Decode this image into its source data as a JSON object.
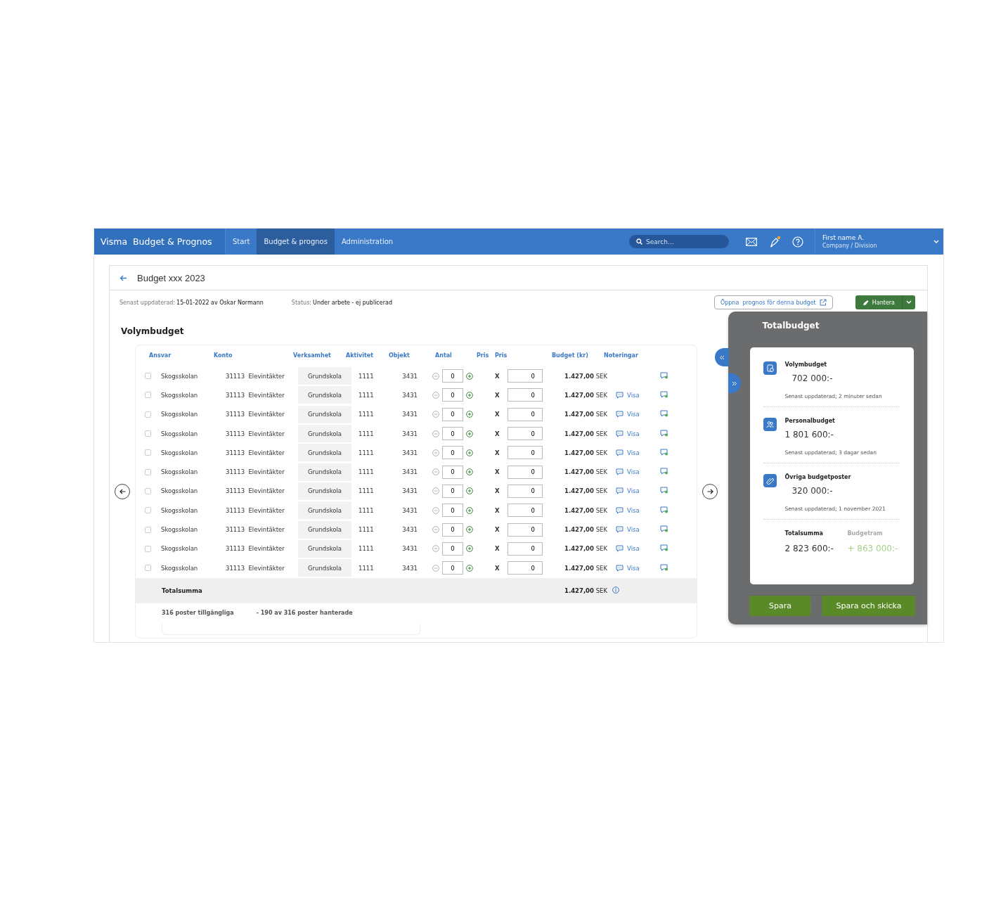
{
  "nav": {
    "brand": "Visma  Budget & Prognos",
    "tabs": [
      {
        "label": "Start",
        "selected": false
      },
      {
        "label": "Budget & prognos",
        "selected": true
      },
      {
        "label": "Administration",
        "selected": false
      }
    ],
    "search": {
      "placeholder": "Search..."
    },
    "user": {
      "name": "First name A.",
      "company": "Company / Division"
    }
  },
  "page": {
    "title": "Budget xxx 2023",
    "updated_label": "Senast uppdaterad:",
    "updated_value": "15-01-2022 av Oskar Normann",
    "status_label": "Status:",
    "status_value": "Under arbete - ej publicerad",
    "open_forecast": "Öppna  prognos för denna budget",
    "manage": "Hantera"
  },
  "table": {
    "title": "Volymbudget",
    "columns": [
      "Ansvar",
      "Konto",
      "Verksamhet",
      "Aktivitet",
      "Objekt",
      "Antal",
      "Pris",
      "Pris",
      "Budget (kr)",
      "Noteringar"
    ],
    "rows": [
      {
        "checked": false,
        "ansvar": "Skogsskolan",
        "konto": "31113  Elevintäkter",
        "verksamhet": "Grundskola",
        "aktivitet": "1111",
        "objekt": "3431",
        "antal": "0",
        "multiply": "X",
        "pris": "0",
        "budget": "**1.427,00** SEK"
      },
      {
        "checked": false,
        "ansvar": "Skogsskolan",
        "konto": "31113  Elevintäkter",
        "verksamhet": "Grundskola",
        "aktivitet": "1111",
        "objekt": "3431",
        "antal": "0",
        "multiply": "X",
        "pris": "0",
        "budget": "**1.427,00** SEK",
        "note": "Visa"
      },
      {
        "checked": false,
        "ansvar": "Skogsskolan",
        "konto": "31113  Elevintäkter",
        "verksamhet": "Grundskola",
        "aktivitet": "1111",
        "objekt": "3431",
        "antal": "0",
        "multiply": "X",
        "pris": "0",
        "budget": "**1.427,00** SEK",
        "note": "Visa"
      },
      {
        "checked": false,
        "ansvar": "Skogsskolan",
        "konto": "31113  Elevintäkter",
        "verksamhet": "Grundskola",
        "aktivitet": "1111",
        "objekt": "3431",
        "antal": "0",
        "multiply": "X",
        "pris": "0",
        "budget": "**1.427,00** SEK",
        "note": "Visa"
      },
      {
        "checked": false,
        "ansvar": "Skogsskolan",
        "konto": "31113  Elevintäkter",
        "verksamhet": "Grundskola",
        "aktivitet": "1111",
        "objekt": "3431",
        "antal": "0",
        "multiply": "X",
        "pris": "0",
        "budget": "**1.427,00** SEK",
        "note": "Visa"
      },
      {
        "checked": false,
        "ansvar": "Skogsskolan",
        "konto": "31113  Elevintäkter",
        "verksamhet": "Grundskola",
        "aktivitet": "1111",
        "objekt": "3431",
        "antal": "0",
        "multiply": "X",
        "pris": "0",
        "budget": "**1.427,00** SEK",
        "note": "Visa"
      },
      {
        "checked": false,
        "ansvar": "Skogsskolan",
        "konto": "31113  Elevintäkter",
        "verksamhet": "Grundskola",
        "aktivitet": "1111",
        "objekt": "3431",
        "antal": "0",
        "multiply": "X",
        "pris": "0",
        "budget": "**1.427,00** SEK",
        "note": "Visa"
      },
      {
        "checked": false,
        "ansvar": "Skogsskolan",
        "konto": "31113  Elevintäkter",
        "verksamhet": "Grundskola",
        "aktivitet": "1111",
        "objekt": "3431",
        "antal": "0",
        "multiply": "X",
        "pris": "0",
        "budget": "**1.427,00** SEK",
        "note": "Visa"
      },
      {
        "checked": false,
        "ansvar": "Skogsskolan",
        "konto": "31113  Elevintäkter",
        "verksamhet": "Grundskola",
        "aktivitet": "1111",
        "objekt": "3431",
        "antal": "0",
        "multiply": "X",
        "pris": "0",
        "budget": "**1.427,00** SEK",
        "note": "Visa"
      },
      {
        "checked": false,
        "ansvar": "Skogsskolan",
        "konto": "31113  Elevintäkter",
        "verksamhet": "Grundskola",
        "aktivitet": "1111",
        "objekt": "3431",
        "antal": "0",
        "multiply": "X",
        "pris": "0",
        "budget": "**1.427,00** SEK",
        "note": "Visa"
      },
      {
        "checked": false,
        "ansvar": "Skogsskolan",
        "konto": "31113  Elevintäkter",
        "verksamhet": "Grundskola",
        "aktivitet": "1111",
        "objekt": "3431",
        "antal": "0",
        "multiply": "X",
        "pris": "0",
        "budget": "**1.427,00** SEK",
        "note": "Visa"
      }
    ],
    "total": {
      "label": "Totalsumma",
      "budget": "**1.427,00** SEK"
    },
    "footer": [
      "316 poster tillgängliga",
      "- 190 av 316 poster hanterade"
    ]
  },
  "summary": {
    "title": "Totalbudget",
    "items": [
      {
        "kind": "volume",
        "title": "Volymbudget",
        "amount": "702 000:-",
        "updated": "Senast uppdaterad; 2 minuter sedan"
      },
      {
        "kind": "staff",
        "title": "Personalbudget",
        "amount": "1 801 600:-",
        "updated": "Senast uppdaterad; 3 dagar sedan"
      },
      {
        "kind": "other",
        "title": "Övriga budgetposter",
        "amount": "320 000:-",
        "updated": "Senast uppdaterad; 1 november 2021"
      }
    ],
    "total_label": "Totalsumma",
    "total_value": "2 823 600:-",
    "frame_label": "Budgetram",
    "frame_value": "+ 863 000:-",
    "buttons": [
      "Spara",
      "Spara och skicka"
    ]
  }
}
